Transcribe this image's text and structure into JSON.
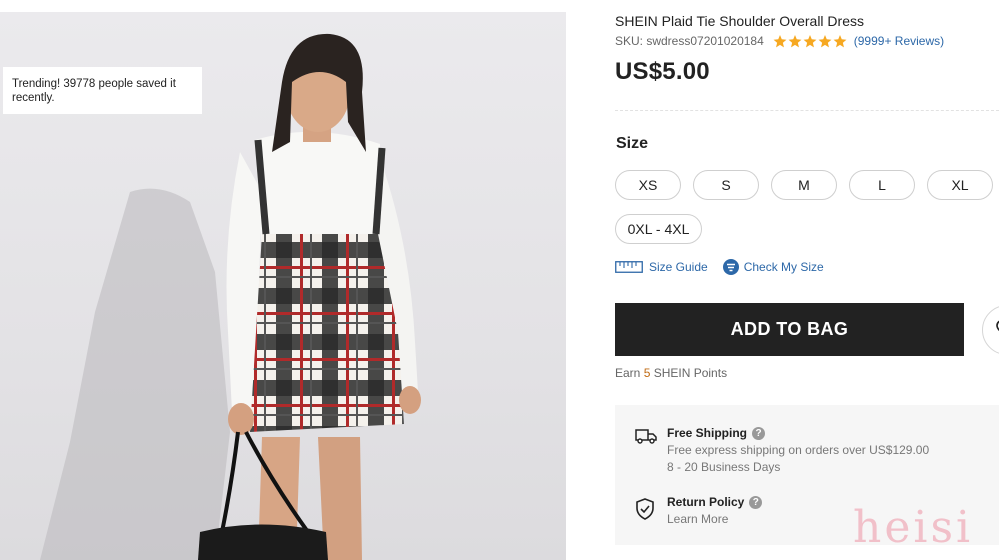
{
  "trending_text": "Trending! 39778 people saved it recently.",
  "product": {
    "title": "SHEIN Plaid Tie Shoulder Overall Dress",
    "sku": "SKU: swdress07201020184",
    "rating": 5,
    "reviews": "(9999+ Reviews)",
    "price": "US$5.00"
  },
  "size": {
    "label": "Size",
    "options": [
      "XS",
      "S",
      "M",
      "L",
      "XL",
      "0XL - 4XL"
    ],
    "guide_label": "Size Guide",
    "check_label": "Check My Size"
  },
  "actions": {
    "add_to_bag": "ADD TO BAG"
  },
  "points": {
    "prefix": "Earn ",
    "value": "5",
    "suffix": " SHEIN Points"
  },
  "shipping": {
    "title": "Free Shipping",
    "line1": "Free express shipping on orders over US$129.00",
    "line2": "8 - 20 Business Days"
  },
  "returns": {
    "title": "Return Policy",
    "link": "Learn More"
  },
  "watermark": "heisi",
  "colors": {
    "accent": "#222222",
    "link": "#2d68a8",
    "star": "#f6a821",
    "points": "#c06b14"
  },
  "icons": [
    "heart-icon",
    "ruler-icon",
    "check-size-icon",
    "truck-icon",
    "shield-icon",
    "question-icon",
    "star-icon"
  ]
}
